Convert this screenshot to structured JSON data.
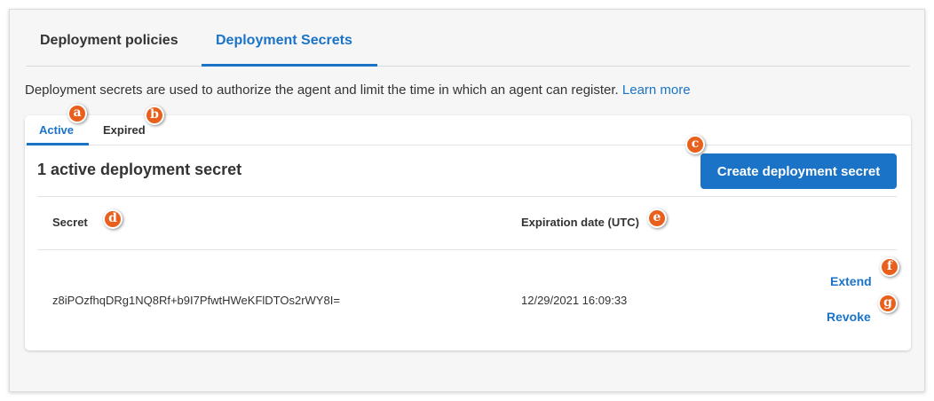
{
  "top_tabs": [
    {
      "label": "Deployment policies"
    },
    {
      "label": "Deployment Secrets"
    }
  ],
  "description": {
    "text": "Deployment secrets are used to authorize the agent and limit the time in which an agent can register.",
    "link": "Learn more"
  },
  "card": {
    "tabs": [
      {
        "label": "Active"
      },
      {
        "label": "Expired"
      }
    ],
    "title": "1 active deployment secret",
    "create_button": "Create deployment secret",
    "table": {
      "headers": {
        "secret": "Secret",
        "expiration": "Expiration date (UTC)"
      },
      "rows": [
        {
          "secret": "z8iPOzfhqDRg1NQ8Rf+b9I7PfwtHWeKFlDTOs2rWY8I=",
          "expiration": "12/29/2021 16:09:33",
          "actions": {
            "extend": "Extend",
            "revoke": "Revoke"
          }
        }
      ]
    }
  },
  "callouts": {
    "a": "a",
    "b": "b",
    "c": "c",
    "d": "d",
    "e": "e",
    "f": "f",
    "g": "g"
  },
  "colors": {
    "accent": "#1a73c7",
    "callout": "#e8601c"
  }
}
